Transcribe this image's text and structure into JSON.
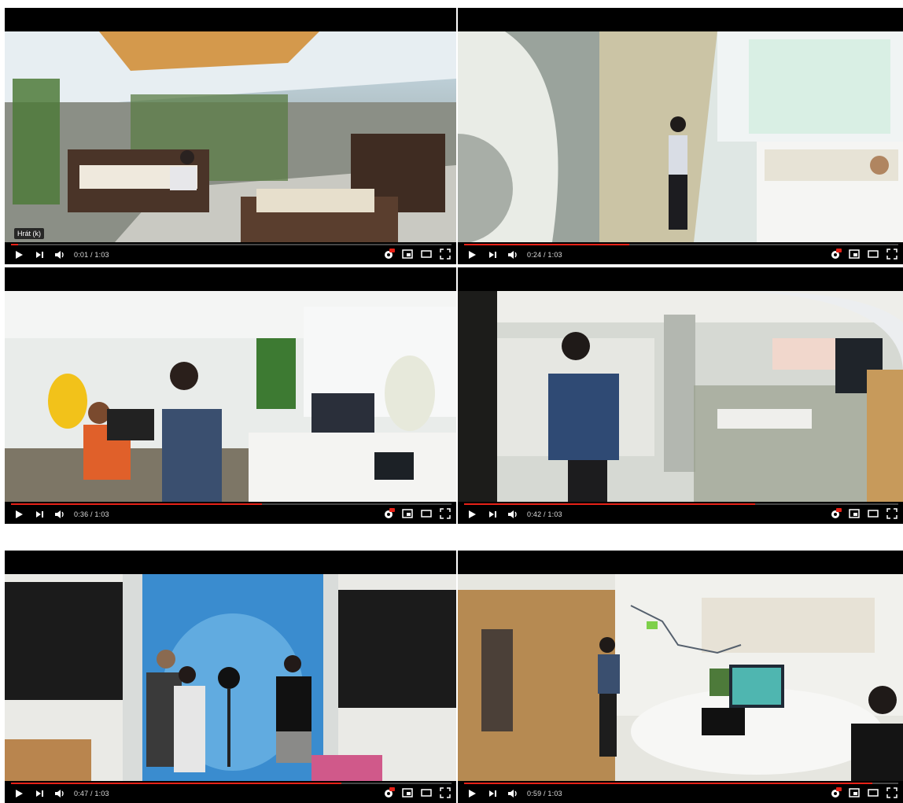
{
  "players": [
    {
      "time": "0:01 / 1:03",
      "progress_fraction": 0.016,
      "tooltip": "Hrát (k)"
    },
    {
      "time": "0:24 / 1:03",
      "progress_fraction": 0.38
    },
    {
      "time": "0:36 / 1:03",
      "progress_fraction": 0.57
    },
    {
      "time": "0:42 / 1:03",
      "progress_fraction": 0.67
    },
    {
      "time": "0:47 / 1:03",
      "progress_fraction": 0.75
    },
    {
      "time": "0:59 / 1:03",
      "progress_fraction": 0.94
    }
  ],
  "colors": {
    "progress_played": "#e62117",
    "player_bg": "#000000"
  },
  "icons": [
    "play-icon",
    "next-icon",
    "volume-icon",
    "settings-hd-icon",
    "miniplayer-icon",
    "theater-icon",
    "fullscreen-icon"
  ]
}
